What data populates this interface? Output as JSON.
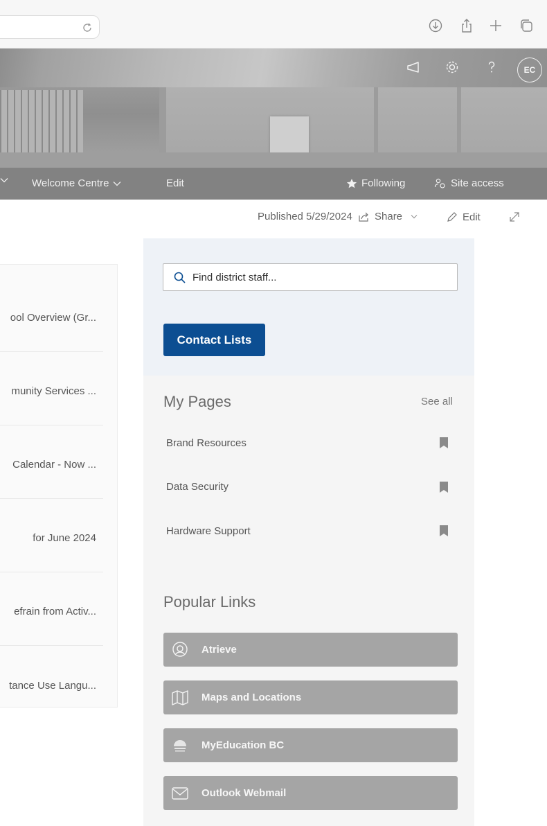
{
  "browser": {
    "icons": [
      "reload-icon",
      "download-icon",
      "share-icon",
      "new-tab-icon",
      "tabs-overview-icon"
    ]
  },
  "header": {
    "icons": [
      "megaphone-icon",
      "gear-icon",
      "help-icon"
    ],
    "avatar_initials": "EC"
  },
  "nav": {
    "items": [
      {
        "label": "Welcome Centre",
        "has_dropdown": true
      },
      {
        "label": "Edit",
        "has_dropdown": false
      }
    ],
    "following_label": "Following",
    "site_access_label": "Site access"
  },
  "command_bar": {
    "published": "Published 5/29/2024",
    "share": "Share",
    "edit": "Edit"
  },
  "news": {
    "items": [
      "ool Overview (Gr...",
      "munity Services ...",
      "Calendar - Now ...",
      "for June 2024",
      "efrain from Activ...",
      "tance Use Langu..."
    ]
  },
  "search": {
    "placeholder": "Find district staff...",
    "contact_button": "Contact Lists"
  },
  "my_pages": {
    "title": "My Pages",
    "see_all": "See all",
    "items": [
      "Brand Resources",
      "Data Security",
      "Hardware Support"
    ]
  },
  "popular_links": {
    "title": "Popular Links",
    "items": [
      {
        "label": "Atrieve",
        "icon": "atrieve-icon"
      },
      {
        "label": "Maps and Locations",
        "icon": "map-icon"
      },
      {
        "label": "MyEducation BC",
        "icon": "bc-logo-icon"
      },
      {
        "label": "Outlook Webmail",
        "icon": "mail-icon"
      }
    ]
  },
  "colors": {
    "accent": "#0c4e92",
    "nav_bg": "#828282",
    "search_panel_bg": "#eef2f7",
    "link_button_bg": "#a5a5a5"
  }
}
